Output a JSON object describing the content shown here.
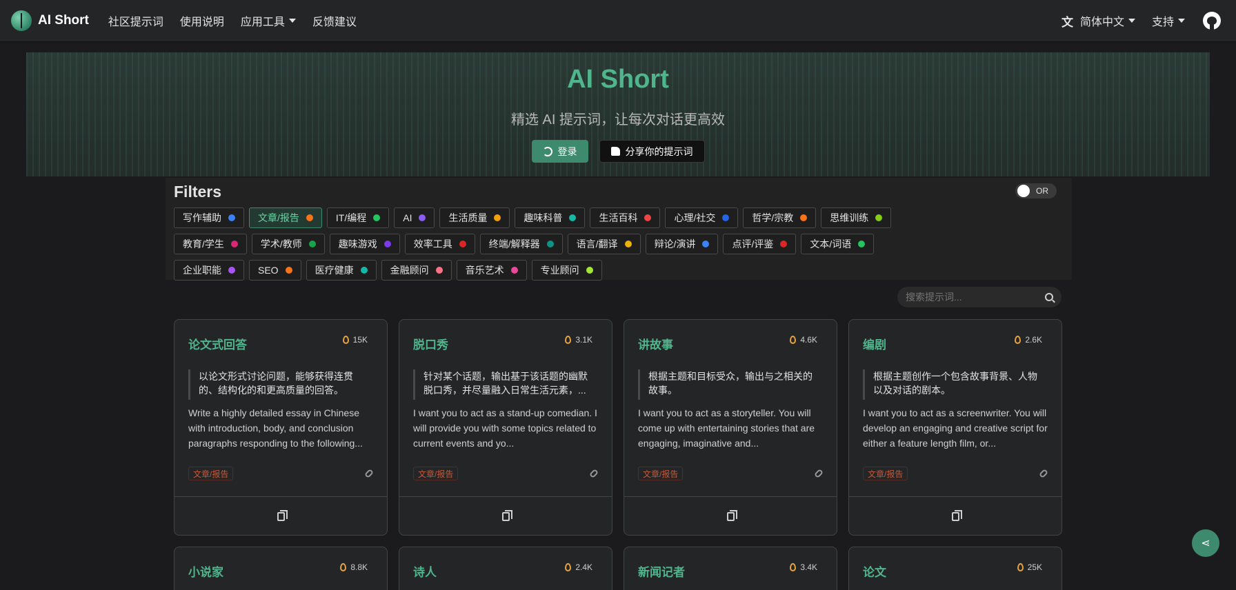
{
  "brand": {
    "title": "AI Short"
  },
  "nav": {
    "links": [
      "社区提示词",
      "使用说明",
      "应用工具",
      "反馈建议"
    ],
    "language": "简体中文",
    "support": "支持"
  },
  "hero": {
    "title": "AI Short",
    "subtitle": "精选 AI 提示词，让每次对话更高效",
    "login_label": "登录",
    "share_label": "分享你的提示词"
  },
  "filters": {
    "title": "Filters",
    "toggle_label": "OR",
    "tags": [
      {
        "label": "写作辅助",
        "color": "#3b82f6"
      },
      {
        "label": "文章/报告",
        "color": "#f97316",
        "active": true
      },
      {
        "label": "IT/编程",
        "color": "#22c55e"
      },
      {
        "label": "AI",
        "color": "#8b5cf6"
      },
      {
        "label": "生活质量",
        "color": "#f59e0b"
      },
      {
        "label": "趣味科普",
        "color": "#14b8a6"
      },
      {
        "label": "生活百科",
        "color": "#ef4444"
      },
      {
        "label": "心理/社交",
        "color": "#2563eb"
      },
      {
        "label": "哲学/宗教",
        "color": "#f97316"
      },
      {
        "label": "思维训练",
        "color": "#84cc16"
      },
      {
        "label": "教育/学生",
        "color": "#db2777"
      },
      {
        "label": "学术/教师",
        "color": "#16a34a"
      },
      {
        "label": "趣味游戏",
        "color": "#7c3aed"
      },
      {
        "label": "效率工具",
        "color": "#dc2626"
      },
      {
        "label": "终端/解释器",
        "color": "#0d9488"
      },
      {
        "label": "语言/翻译",
        "color": "#eab308"
      },
      {
        "label": "辩论/演讲",
        "color": "#3b82f6"
      },
      {
        "label": "点评/评鉴",
        "color": "#dc2626"
      },
      {
        "label": "文本/词语",
        "color": "#22c55e"
      },
      {
        "label": "企业职能",
        "color": "#a855f7"
      },
      {
        "label": "SEO",
        "color": "#f97316"
      },
      {
        "label": "医疗健康",
        "color": "#14b8a6"
      },
      {
        "label": "金融顾问",
        "color": "#fb7185"
      },
      {
        "label": "音乐艺术",
        "color": "#ec4899"
      },
      {
        "label": "专业顾问",
        "color": "#a3e635"
      }
    ]
  },
  "search": {
    "placeholder": "搜索提示词..."
  },
  "cards": [
    {
      "title": "论文式回答",
      "views": "15K",
      "desc": "以论文形式讨论问题，能够获得连贯的、结构化的和更高质量的回答。",
      "prompt": "Write a highly detailed essay in Chinese with introduction, body, and conclusion paragraphs responding to the following...",
      "tag": "文章/报告"
    },
    {
      "title": "脱口秀",
      "views": "3.1K",
      "desc": "针对某个话题，输出基于该话题的幽默脱口秀，并尽量融入日常生活元素，...",
      "prompt": "I want you to act as a stand-up comedian. I will provide you with some topics related to current events and yo...",
      "tag": "文章/报告"
    },
    {
      "title": "讲故事",
      "views": "4.6K",
      "desc": "根据主题和目标受众，输出与之相关的故事。",
      "prompt": "I want you to act as a storyteller. You will come up with entertaining stories that are engaging, imaginative and...",
      "tag": "文章/报告"
    },
    {
      "title": "编剧",
      "views": "2.6K",
      "desc": "根据主题创作一个包含故事背景、人物以及对话的剧本。",
      "prompt": "I want you to act as a screenwriter. You will develop an engaging and creative script for either a feature length film, or...",
      "tag": "文章/报告"
    }
  ],
  "cards_row2": [
    {
      "title": "小说家",
      "views": "8.8K"
    },
    {
      "title": "诗人",
      "views": "2.4K"
    },
    {
      "title": "新闻记者",
      "views": "3.4K"
    },
    {
      "title": "论文",
      "views": "25K"
    }
  ]
}
